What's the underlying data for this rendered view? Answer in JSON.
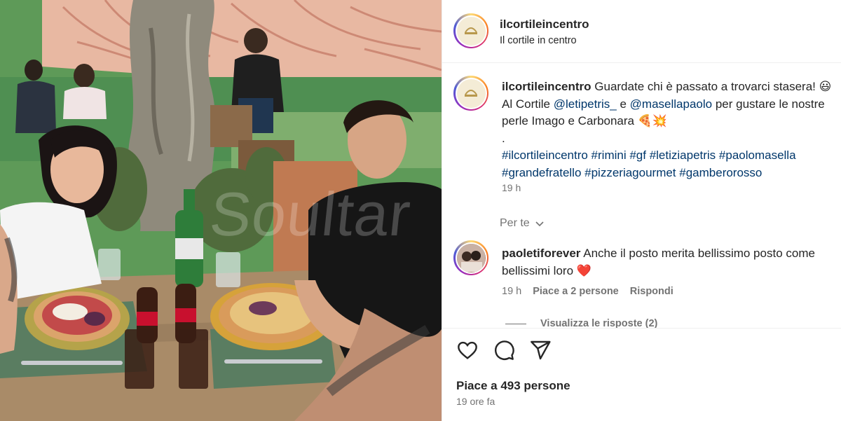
{
  "post": {
    "username": "ilcortileincentro",
    "location": "Il cortile in centro",
    "watermark": "Soultar",
    "caption": {
      "username": "ilcortileincentro",
      "line1": "Guardate chi è passato a trovarci stasera! 😃",
      "al_cortile": "Al Cortile",
      "mention1": "@letipetris_",
      "and": "e",
      "mention2": "@masellapaolo",
      "rest": "per gustare le nostre perle Imago e Carbonara 🍕💥",
      "dot": ".",
      "hashtags_line1": "#ilcortileincentro #rimini #gf #letiziapetris #paolomasella",
      "hashtags_line2": "#grandefratello #pizzeriagourmet #gamberorosso",
      "time": "19 h"
    },
    "for_you": "Per te",
    "comment": {
      "username": "paoletiforever",
      "text": "Anche il posto merita bellissimo posto come bellissimi loro ❤️",
      "time": "19 h",
      "likes": "Piace a 2 persone",
      "reply": "Rispondi",
      "view_replies": "Visualizza le risposte (2)"
    },
    "actions": {
      "like_icon": "heart-icon",
      "comment_icon": "comment-icon",
      "share_icon": "send-icon"
    },
    "likes_count": "Piace a 493 persone",
    "posted_ago": "19 ore fa"
  },
  "colors": {
    "text": "#262626",
    "muted": "#737373",
    "link": "#00376b",
    "heart": "#ed4956"
  }
}
